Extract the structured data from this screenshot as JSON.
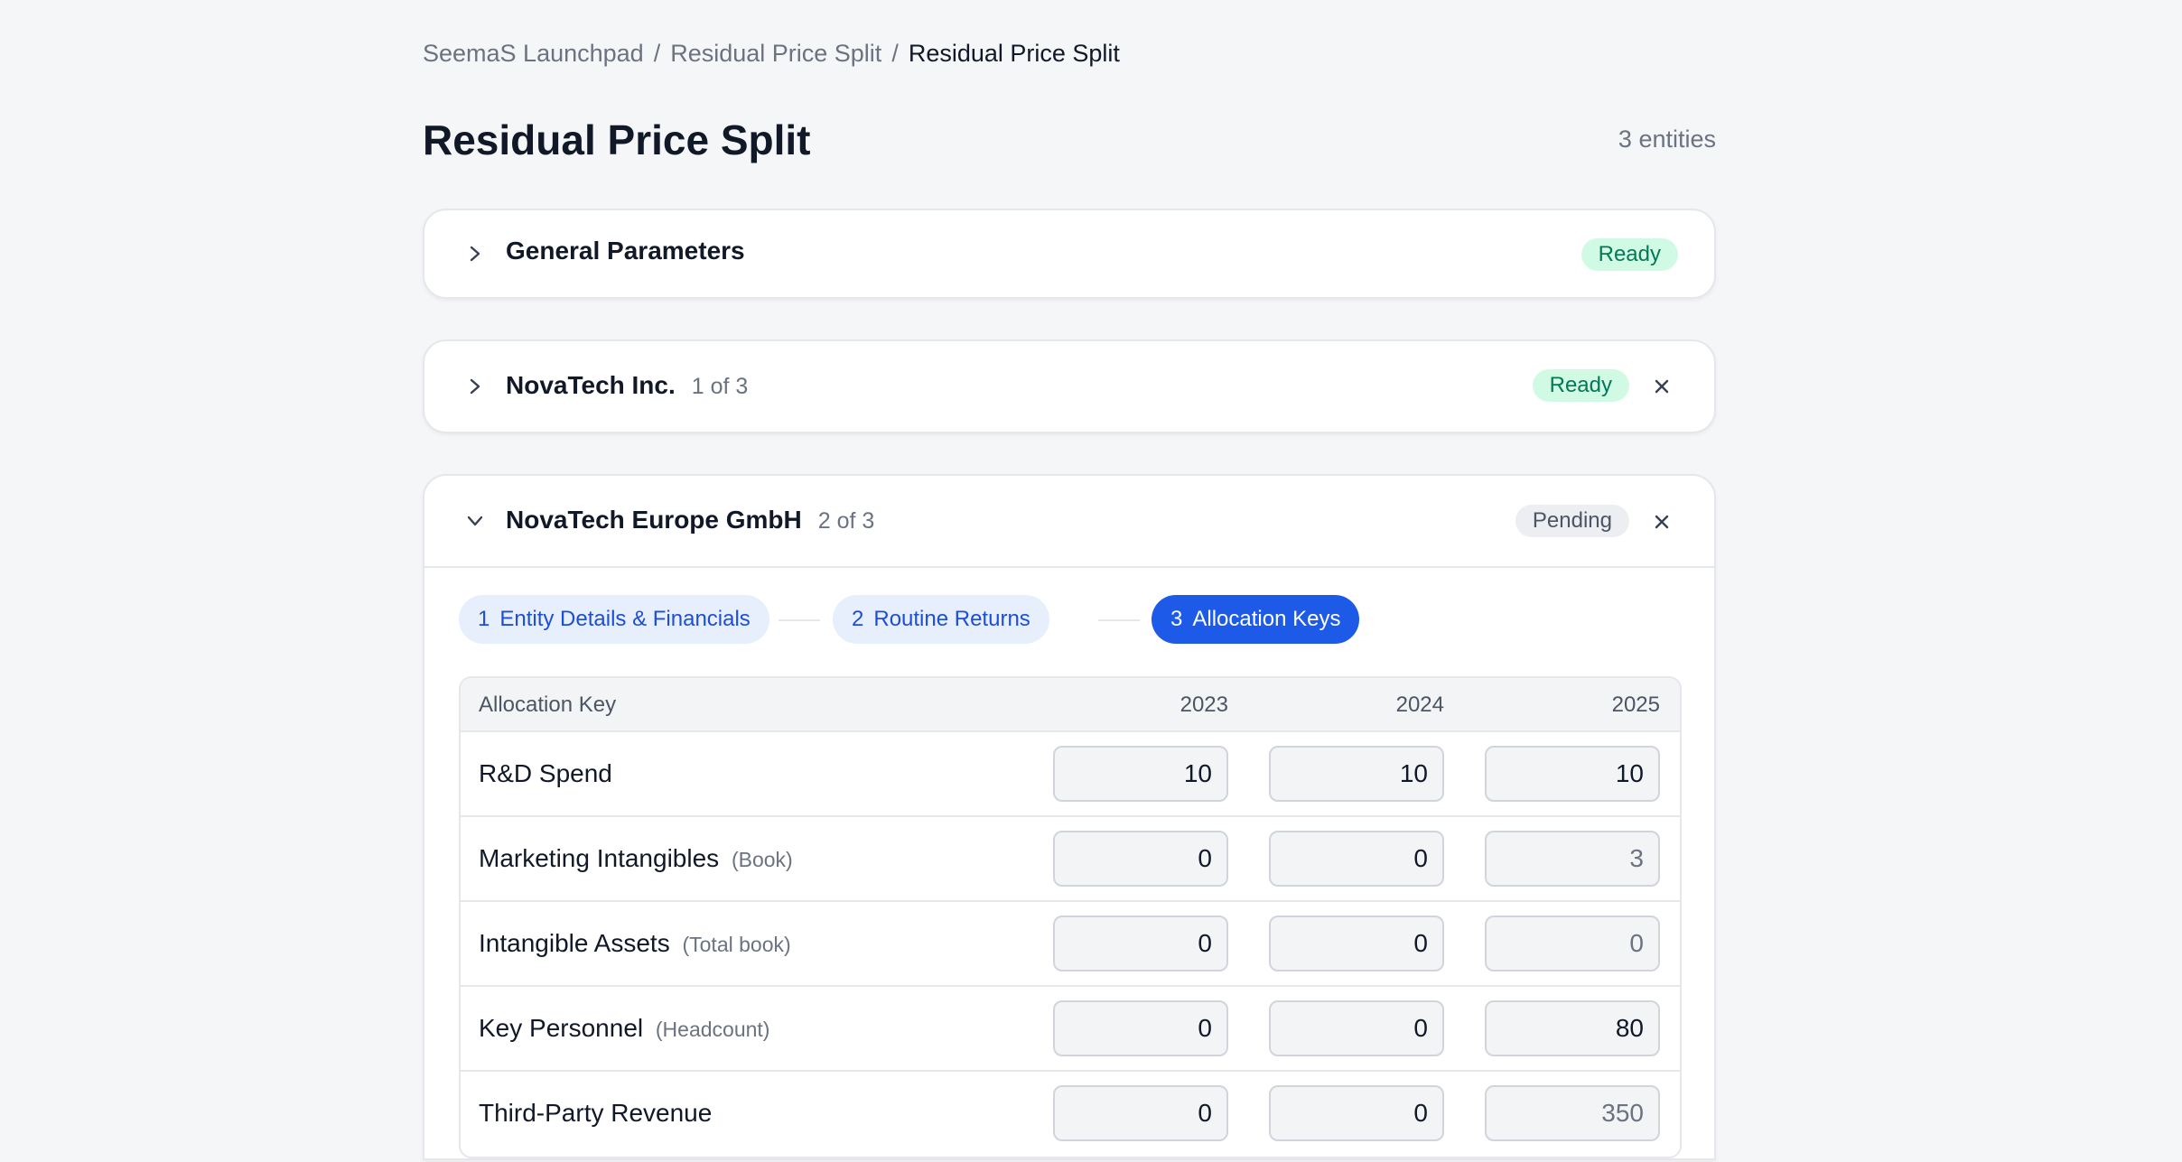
{
  "breadcrumb": {
    "items": [
      "SeemaS Launchpad",
      "Residual Price Split",
      "Residual Price Split"
    ],
    "separator": "/"
  },
  "page": {
    "title": "Residual Price Split",
    "entity_count": "3 entities"
  },
  "sections": {
    "general": {
      "title": "General Parameters",
      "status": "Ready"
    },
    "entity1": {
      "title": "NovaTech Inc.",
      "position": "1 of 3",
      "status": "Ready"
    },
    "entity2": {
      "title": "NovaTech Europe GmbH",
      "position": "2 of 3",
      "status": "Pending"
    }
  },
  "steps": [
    {
      "num": "1",
      "label": "Entity Details & Financials",
      "state": "done"
    },
    {
      "num": "2",
      "label": "Routine Returns",
      "state": "done"
    },
    {
      "num": "3",
      "label": "Allocation Keys",
      "state": "active"
    }
  ],
  "table": {
    "headers": {
      "key": "Allocation Key",
      "years": [
        "2023",
        "2024",
        "2025"
      ]
    },
    "rows": [
      {
        "label": "R&D Spend",
        "hint": "",
        "values": [
          "10",
          "10",
          "10"
        ]
      },
      {
        "label": "Marketing Intangibles",
        "hint": "(Book)",
        "values": [
          "0",
          "0",
          "3"
        ]
      },
      {
        "label": "Intangible Assets",
        "hint": "(Total book)",
        "values": [
          "0",
          "0",
          "0"
        ]
      },
      {
        "label": "Key Personnel",
        "hint": "(Headcount)",
        "values": [
          "0",
          "0",
          "80"
        ]
      },
      {
        "label": "Third-Party Revenue",
        "hint": "",
        "values": [
          "0",
          "0",
          "350"
        ]
      }
    ]
  },
  "colors": {
    "accent": "#1d5ae8",
    "ready_bg": "#d1fae5",
    "ready_text": "#047857",
    "pending_bg": "#eceef1"
  },
  "icons": {
    "expand": "chevron-right-icon",
    "collapse": "chevron-down-icon",
    "remove": "close-icon"
  }
}
